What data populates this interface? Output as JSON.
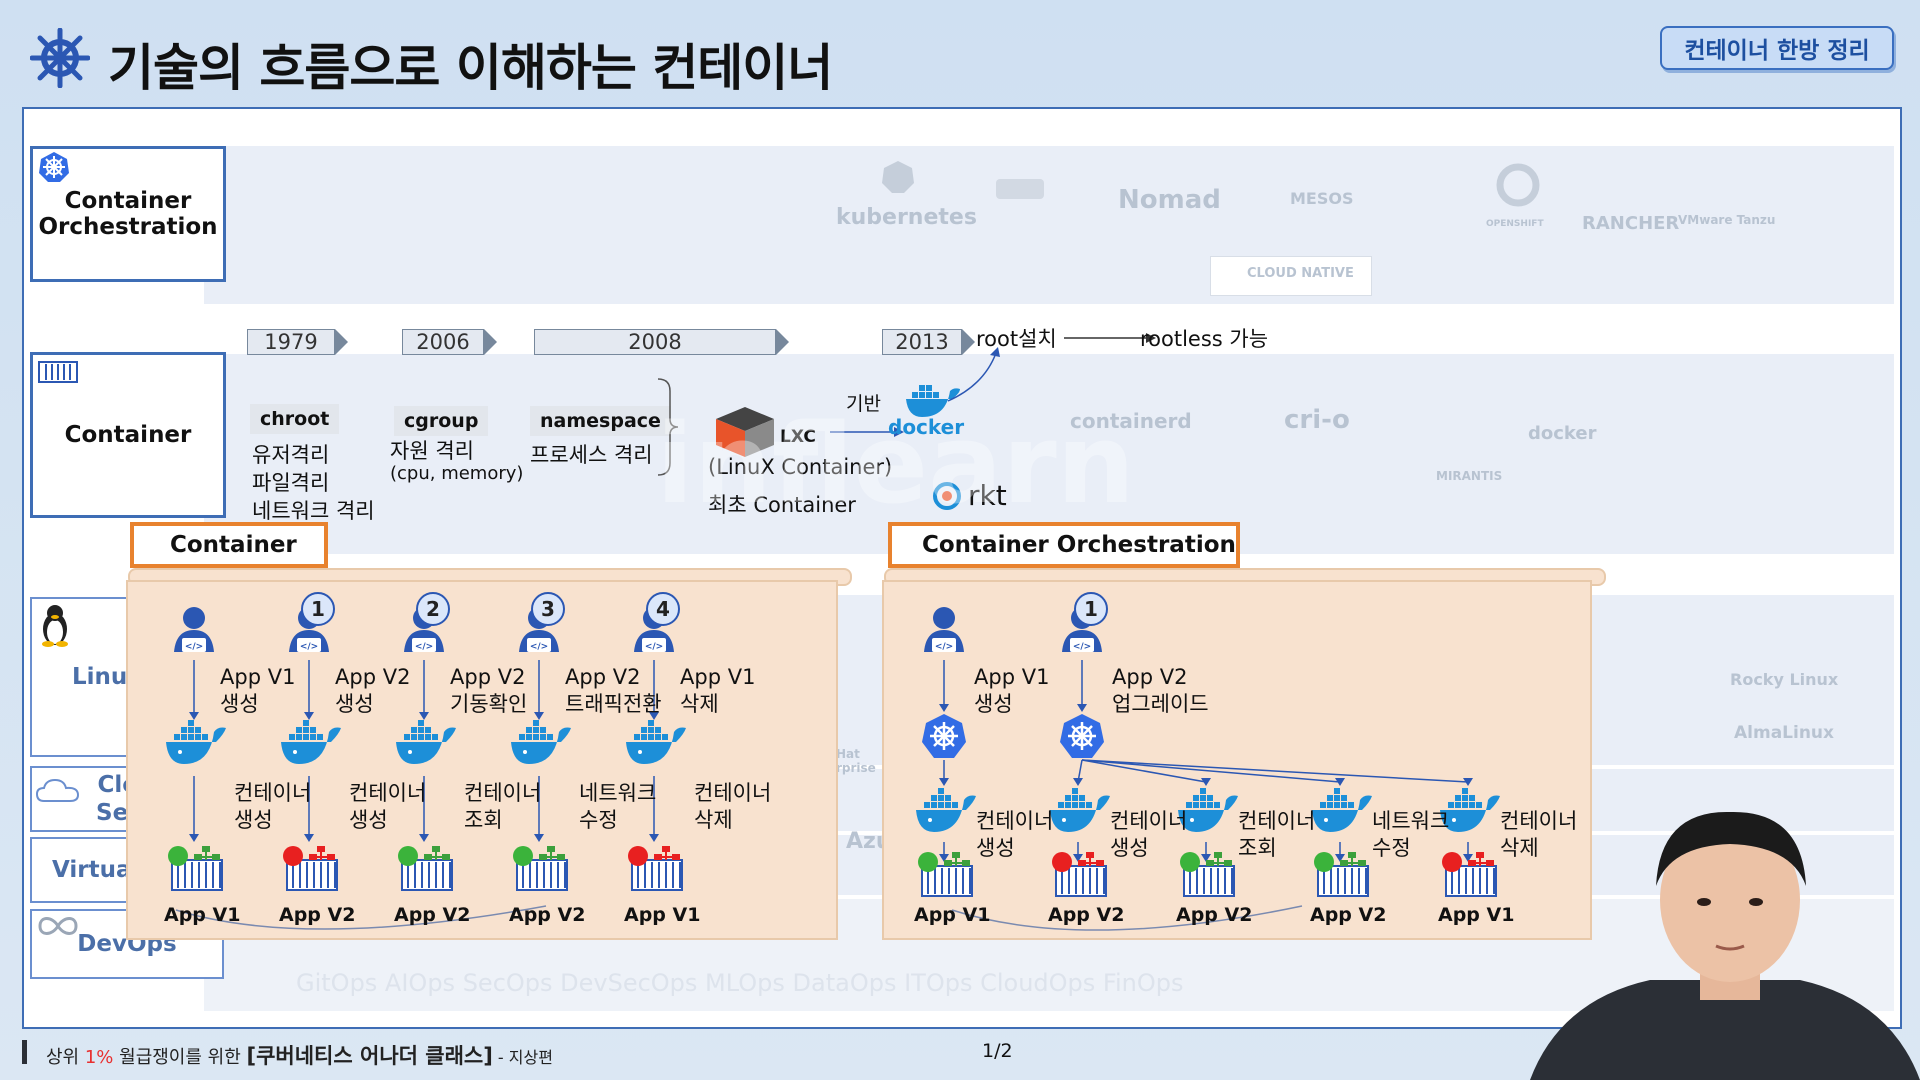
{
  "header": {
    "title": "기술의 흐름으로 이해하는 컨테이너",
    "badge": "컨테이너 한방 정리"
  },
  "categories": {
    "orchestration": "Container\nOrchestration",
    "container": "Container",
    "linux": "Linu",
    "cloud": "Clo\nSer",
    "virtual": "Virtual",
    "devops": "DevOps"
  },
  "orchestration_logos": [
    "kubernetes",
    "Nomad",
    "MESOS",
    "OPENSHIFT",
    "RANCHER",
    "VMware Tanzu",
    "CLOUD NATIVE"
  ],
  "timeline": {
    "years": [
      "1979",
      "2006",
      "2008",
      "2013"
    ],
    "chroot": {
      "chip": "chroot",
      "lines": [
        "유저격리",
        "파일격리",
        "네트워크 격리"
      ]
    },
    "cgroup": {
      "chip": "cgroup",
      "lines": [
        "자원 격리",
        "(cpu, memory)"
      ]
    },
    "namespace": {
      "chip": "namespace",
      "lines": [
        "프로세스 격리"
      ]
    },
    "lxc": {
      "logo": "LXC",
      "base_label": "기반",
      "lines": [
        "(LinuX Container)",
        "최초 Container"
      ]
    },
    "docker": {
      "logo": "docker",
      "root": "root설치",
      "rootless": "rootless 가능"
    },
    "rkt": "rkt",
    "faint_logos": [
      "containerd",
      "cri-o",
      "docker",
      "MIRANTIS",
      "Rocky Linux",
      "AlmaLinux",
      "Hat",
      "rprise",
      "Azu"
    ],
    "devops_terms": "GitOps  AIOps  SecOps  DevSecOps  MLOps  DataOps  ITOps  CloudOps FinOps"
  },
  "container_panel": {
    "title": "Container",
    "steps": [
      {
        "num": "",
        "action": "App V1\n생성",
        "op": "컨테이너\n생성",
        "app": "App V1",
        "status": "green"
      },
      {
        "num": "1",
        "action": "App V2\n생성",
        "op": "컨테이너\n생성",
        "app": "App V2",
        "status": "red"
      },
      {
        "num": "2",
        "action": "App V2\n기동확인",
        "op": "컨테이너\n조회",
        "app": "App V2",
        "status": "green"
      },
      {
        "num": "3",
        "action": "App V2\n트래픽전환",
        "op": "네트워크\n수정",
        "app": "App V2",
        "status": "green"
      },
      {
        "num": "4",
        "action": "App V1\n삭제",
        "op": "컨테이너\n삭제",
        "app": "App V1",
        "status": "red"
      }
    ]
  },
  "orchestration_panel": {
    "title": "Container Orchestration",
    "actions": [
      {
        "num": "",
        "text": "App V1\n생성"
      },
      {
        "num": "1",
        "text": "App V2\n업그레이드"
      }
    ],
    "targets": [
      {
        "op": "컨테이너\n생성",
        "app": "App V1",
        "status": "green"
      },
      {
        "op": "컨테이너\n생성",
        "app": "App V2",
        "status": "red"
      },
      {
        "op": "컨테이너\n조회",
        "app": "App V2",
        "status": "green"
      },
      {
        "op": "네트워크\n수정",
        "app": "App V2",
        "status": "green"
      },
      {
        "op": "컨테이너\n삭제",
        "app": "App V1",
        "status": "red"
      }
    ]
  },
  "footer": {
    "prefix": "상위 ",
    "highlight": "1%",
    "middle": " 월급쟁이를 위한 ",
    "course": "[쿠버네티스 어나더 클래스]",
    "suffix": " - 지상편",
    "page": "1/2"
  },
  "colors": {
    "accent": "#3e6db5",
    "panel": "#f8e2cf",
    "panel_border": "#e8822e",
    "ok": "#3bb33b",
    "bad": "#e82020",
    "docker": "#1d8fd8"
  }
}
